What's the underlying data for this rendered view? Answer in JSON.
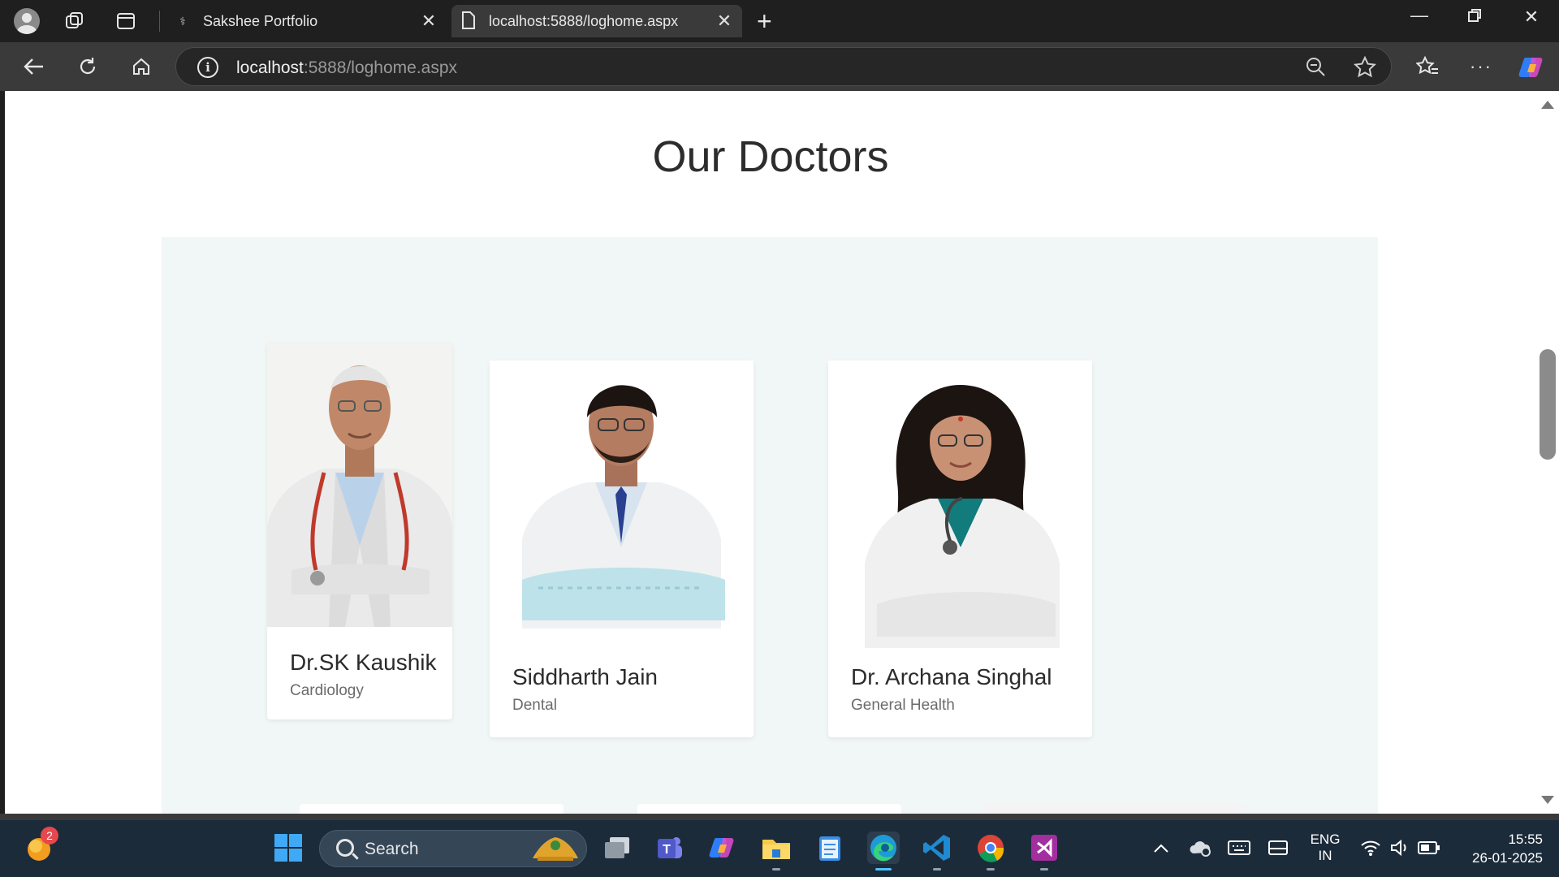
{
  "browser": {
    "tabs": [
      {
        "label": "Sakshee Portfolio",
        "active": false
      },
      {
        "label": "localhost:5888/loghome.aspx",
        "active": true
      }
    ],
    "address": {
      "host": "localhost",
      "rest": ":5888/loghome.aspx"
    }
  },
  "page": {
    "heading": "Our Doctors",
    "doctors": [
      {
        "name": "Dr.SK Kaushik",
        "specialty": "Cardiology"
      },
      {
        "name": "Siddharth Jain",
        "specialty": "Dental"
      },
      {
        "name": "Dr. Archana Singhal",
        "specialty": "General Health"
      }
    ]
  },
  "taskbar": {
    "widgets_badge": "2",
    "search_label": "Search",
    "language": {
      "line1": "ENG",
      "line2": "IN"
    },
    "clock": {
      "time": "15:55",
      "date": "26-01-2025"
    }
  },
  "colors": {
    "browser_chrome": "#1f1f1f",
    "toolbar": "#3a3a3a",
    "panel_background": "#f1f7f6",
    "taskbar": "#1c2b3a"
  }
}
